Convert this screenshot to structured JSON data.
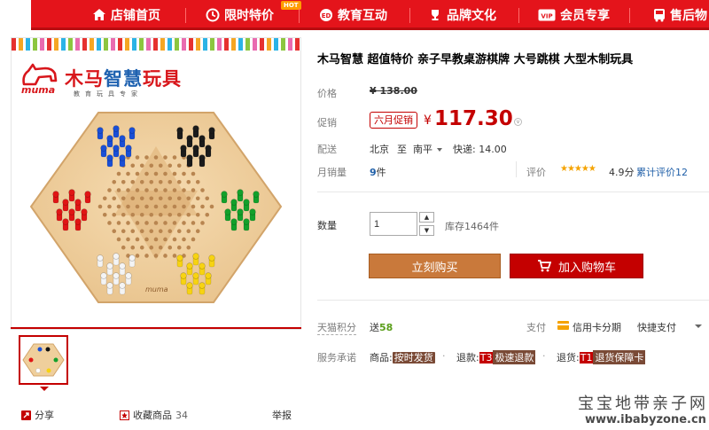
{
  "nav": {
    "items": [
      {
        "label": "店铺首页",
        "icon": "home-icon"
      },
      {
        "label": "限时特价",
        "icon": "clock-icon"
      },
      {
        "label": "教育互动",
        "icon": "education-icon"
      },
      {
        "label": "品牌文化",
        "icon": "trophy-icon"
      },
      {
        "label": "会员专享",
        "icon": "vip-icon"
      },
      {
        "label": "售后物",
        "icon": "bus-icon"
      }
    ],
    "hot_badge": "HOT"
  },
  "gallery": {
    "brand_name_red": "木马",
    "brand_name_blue": "智慧",
    "brand_name_red2": "玩具",
    "brand_slogan": "教育玩具专家",
    "logo_text": "muma",
    "share_label": "分享",
    "collect_label": "收藏商品",
    "collect_count": "34",
    "report_label": "举报"
  },
  "product": {
    "title": "木马智慧 超值特价 亲子早教桌游棋牌 大号跳棋 大型木制玩具",
    "price_label": "价格",
    "price_old": "¥ 138.00",
    "promo_label": "促销",
    "promo_badge": "六月促销",
    "currency": "¥",
    "price_now": "117.30",
    "delivery_label": "配送",
    "delivery_from": "北京",
    "delivery_to_word": "至",
    "delivery_city": "南平",
    "delivery_fee": "快递: 14.00",
    "monthly_sales_label": "月销量",
    "monthly_sales_value": "9",
    "monthly_sales_unit": "件",
    "rating_label": "评价",
    "stars": "★★★★★",
    "rating_score": "4.9分",
    "review_text": "累计评价12",
    "quantity_label": "数量",
    "quantity_value": "1",
    "stock": "库存1464件",
    "buy_now": "立刻购买",
    "add_to_cart": "加入购物车",
    "tmall_points_label": "天猫积分",
    "points_text": "送",
    "points_value": "58",
    "payment_label": "支付",
    "credit_card": "信用卡分期",
    "quick_pay": "快捷支付",
    "service_label": "服务承诺",
    "svc1_prefix": "商品:",
    "svc1_tag": "按时发货",
    "svc2_prefix": "退款:",
    "svc2_code": "T3",
    "svc2_tag": "极速退款",
    "svc3_prefix": "退货:",
    "svc3_code": "T1",
    "svc3_tag": "退货保障卡"
  },
  "watermark": {
    "line1": "宝宝地带亲子网",
    "line2": "www.ibabyzone.cn"
  },
  "colors": {
    "nav_red": "#e4141b",
    "price_red": "#c40000",
    "buy_brown": "#c9793b",
    "link_blue": "#1f5fa8"
  }
}
